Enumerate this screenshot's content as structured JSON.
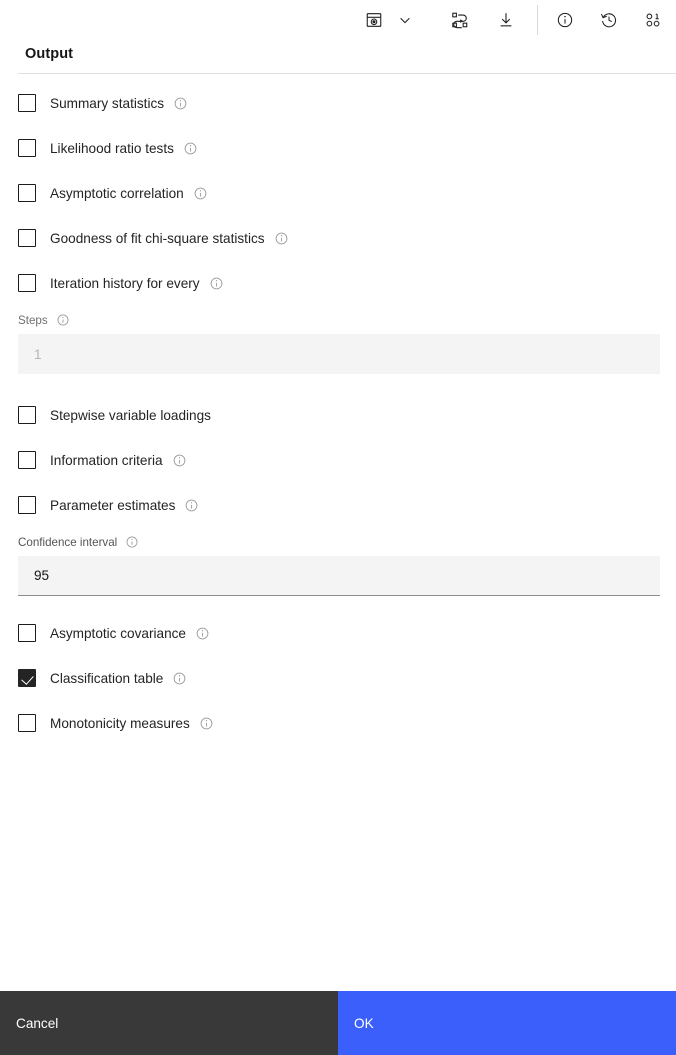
{
  "toolbar": {
    "icons": [
      {
        "name": "save-view-icon",
        "label": "Save view"
      },
      {
        "name": "chevron-down-icon",
        "label": "More view options"
      },
      {
        "name": "transform-variable-icon",
        "label": "Transform"
      },
      {
        "name": "download-icon",
        "label": "Download"
      },
      {
        "name": "info-icon",
        "label": "Information"
      },
      {
        "name": "history-icon",
        "label": "History"
      },
      {
        "name": "variables-icon",
        "label": "Variables"
      }
    ]
  },
  "section": {
    "title": "Output"
  },
  "options": [
    {
      "label": "Summary statistics",
      "checked": false,
      "info": true
    },
    {
      "label": "Likelihood ratio tests",
      "checked": false,
      "info": true
    },
    {
      "label": "Asymptotic correlation",
      "checked": false,
      "info": true
    },
    {
      "label": "Goodness of fit chi-square statistics",
      "checked": false,
      "info": true
    },
    {
      "label": "Iteration history for every",
      "checked": false,
      "info": true
    }
  ],
  "steps_field": {
    "label": "Steps",
    "info": true,
    "value": "",
    "placeholder": "1",
    "disabled": true
  },
  "options2": [
    {
      "label": "Stepwise variable loadings",
      "checked": false,
      "info": false
    },
    {
      "label": "Information criteria",
      "checked": false,
      "info": true
    },
    {
      "label": "Parameter estimates",
      "checked": false,
      "info": true
    }
  ],
  "confidence_field": {
    "label": "Confidence interval",
    "info": true,
    "value": "95",
    "placeholder": ""
  },
  "options3": [
    {
      "label": "Asymptotic covariance",
      "checked": false,
      "info": true
    },
    {
      "label": "Classification table",
      "checked": true,
      "info": true
    },
    {
      "label": "Monotonicity measures",
      "checked": false,
      "info": true
    }
  ],
  "footer": {
    "cancel_label": "Cancel",
    "ok_label": "OK"
  },
  "colors": {
    "primary": "#3b5ffb",
    "cancel": "#393939",
    "field_bg": "#f4f4f4",
    "text": "#161616"
  }
}
